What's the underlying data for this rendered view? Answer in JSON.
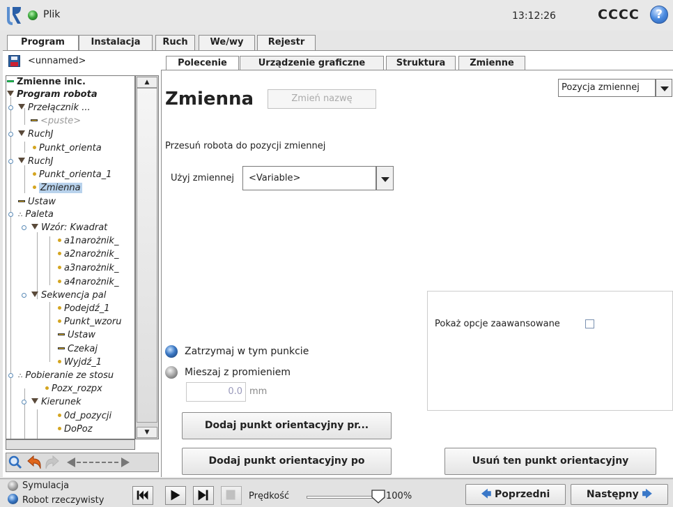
{
  "header": {
    "file_label": "Plik",
    "time": "13:12:26",
    "robot_name": "CCCC",
    "help": "?"
  },
  "main_tabs": [
    "Program",
    "Instalacja",
    "Ruch",
    "We/wy",
    "Rejestr"
  ],
  "program_name": "<unnamed>",
  "tree": {
    "n01": "Zmienne inic.",
    "n02": "Program robota",
    "n03": "Przełącznik ...",
    "n04": "<puste>",
    "n05": "RuchJ",
    "n06": "Punkt_orienta",
    "n07": "RuchJ",
    "n08": "Punkt_orienta_1",
    "n09": "Zmienna",
    "n10": "Ustaw",
    "n11": "Paleta",
    "n12": "Wzór: Kwadrat",
    "n13": "a1narożnik_",
    "n14": "a2narożnik_",
    "n15": "a3narożnik_",
    "n16": "a4narożnik_",
    "n17": "Sekwencja pal",
    "n18": "Podejdź_1",
    "n19": "Punkt_wzoru",
    "n20": "Ustaw",
    "n21": "Czekaj",
    "n22": "Wyjdź_1",
    "n23": "Pobieranie ze stosu",
    "n24": "Pozx_rozpx",
    "n25": "Kierunek",
    "n26": "0d_pozycji",
    "n27": "DoPoz"
  },
  "sub_tabs": [
    "Polecenie",
    "Urządzenie graficzne",
    "Struktura",
    "Zmienne"
  ],
  "command": {
    "title": "Zmienna",
    "rename_button": "Zmień nazwę",
    "position_select": "Pozycja zmiennej",
    "instruction": "Przesuń robota do pozycji zmiennej",
    "use_variable_label": "Użyj zmiennej",
    "variable_value": "<Variable>",
    "advanced_label": "Pokaż opcje zaawansowane",
    "stop_label": "Zatrzymaj w tym punkcie",
    "blend_label": "Mieszaj z promieniem",
    "radius_value": "0.0",
    "radius_unit": "mm",
    "add_before": "Dodaj punkt orientacyjny pr...",
    "add_after": "Dodaj punkt orientacyjny po",
    "delete": "Usuń ten punkt orientacyjny"
  },
  "footer": {
    "simulation": "Symulacja",
    "real_robot": "Robot rzeczywisty",
    "speed_label": "Prędkość",
    "speed_value": "100%",
    "speed_fraction": 1.0,
    "prev": "Poprzedni",
    "next": "Następny"
  }
}
